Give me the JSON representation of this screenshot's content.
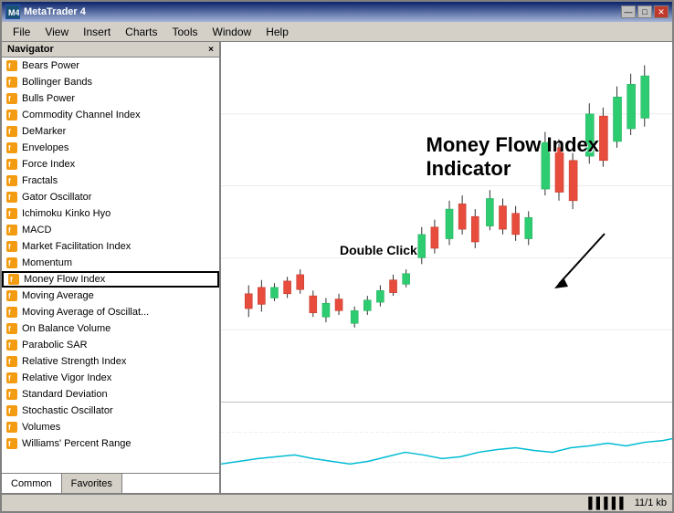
{
  "window": {
    "title": "MetaTrader 4",
    "icon": "MT"
  },
  "title_controls": {
    "minimize": "—",
    "maximize": "□",
    "close": "✕"
  },
  "menu": {
    "items": [
      "File",
      "View",
      "Insert",
      "Charts",
      "Tools",
      "Window",
      "Help"
    ]
  },
  "navigator": {
    "title": "Navigator",
    "close_label": "×",
    "items": [
      "Bears Power",
      "Bollinger Bands",
      "Bulls Power",
      "Commodity Channel Index",
      "DeMarker",
      "Envelopes",
      "Force Index",
      "Fractals",
      "Gator Oscillator",
      "Ichimoku Kinko Hyo",
      "MACD",
      "Market Facilitation Index",
      "Momentum",
      "Money Flow Index",
      "Moving Average",
      "Moving Average of Oscillat...",
      "On Balance Volume",
      "Parabolic SAR",
      "Relative Strength Index",
      "Relative Vigor Index",
      "Standard Deviation",
      "Stochastic Oscillator",
      "Volumes",
      "Williams' Percent Range"
    ],
    "selected_index": 13,
    "tabs": [
      "Common",
      "Favorites"
    ]
  },
  "chart": {
    "annotation": "Money Flow Index\nIndicator",
    "double_click_label": "Double Click",
    "arrow_label": "↘"
  },
  "status_bar": {
    "icon": "▌▌▌▌▌",
    "info": "11/1 kb"
  }
}
